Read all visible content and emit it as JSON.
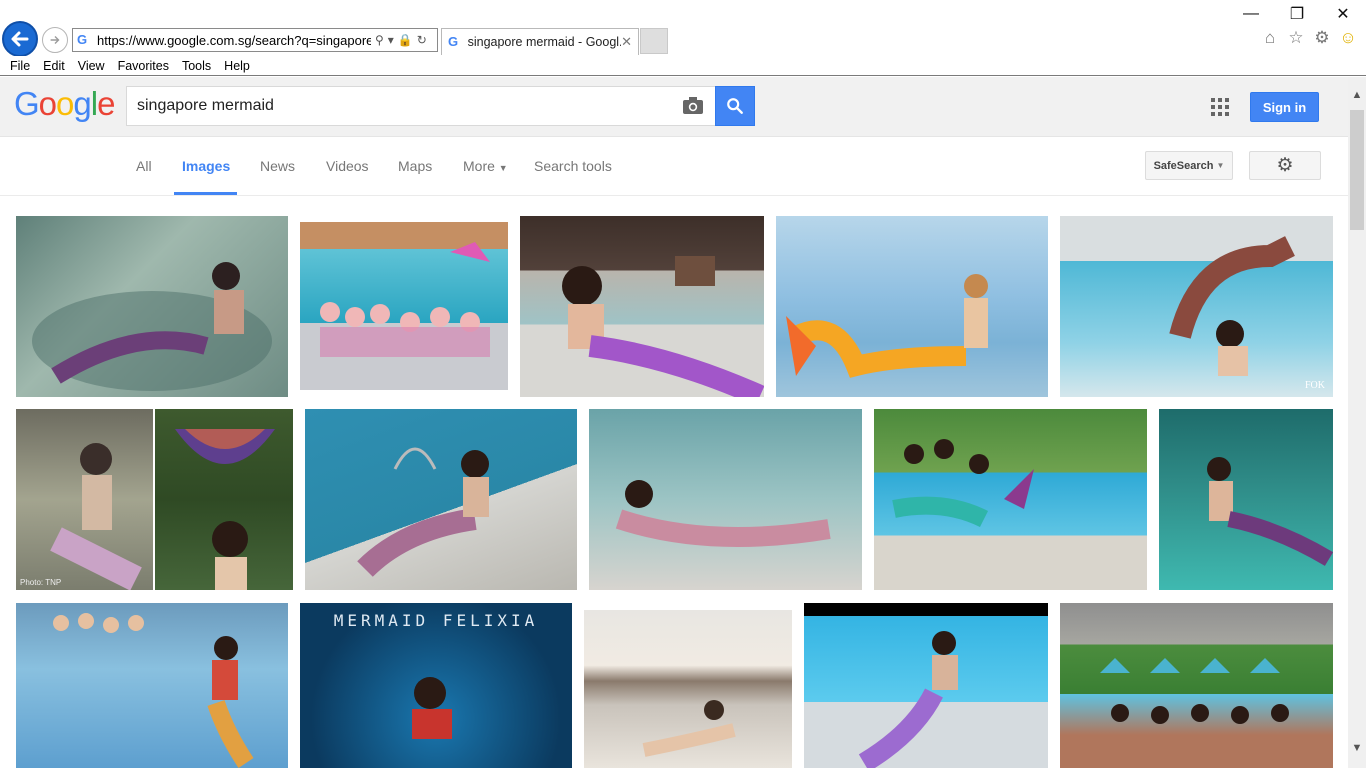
{
  "browser": {
    "address": "https://www.google.com.sg/search?q=singapore+mermaid&tbm=isch",
    "tab_title": "singapore mermaid - Googl...",
    "menu": [
      "File",
      "Edit",
      "View",
      "Favorites",
      "Tools",
      "Help"
    ]
  },
  "google": {
    "search_query": "singapore mermaid",
    "signin_label": "Sign in",
    "nav_tabs": [
      "All",
      "Images",
      "News",
      "Videos",
      "Maps",
      "More",
      "Search tools"
    ],
    "safesearch_label": "SafeSearch"
  },
  "results": {
    "captions": {
      "tnp": "Photo: TNP",
      "fok": "FOK",
      "felixia": "MERMAID FELIXIA"
    }
  },
  "colors": {
    "accent": "#4285f4",
    "ie_back": "#1a6ad3"
  }
}
